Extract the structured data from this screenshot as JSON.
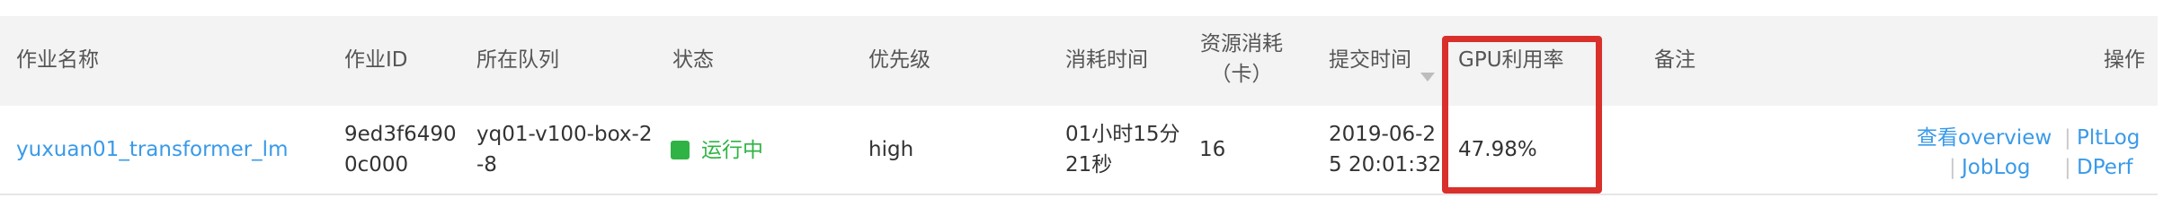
{
  "headers": {
    "name": "作业名称",
    "id": "作业ID",
    "queue": "所在队列",
    "status": "状态",
    "priority": "优先级",
    "elapsed": "消耗时间",
    "resource_line1": "资源消耗",
    "resource_line2": "（卡）",
    "submit": "提交时间",
    "gpu": "GPU利用率",
    "note": "备注",
    "actions": "操作"
  },
  "row": {
    "name": "yuxuan01_transformer_lm",
    "id_line1": "9ed3f6490",
    "id_line2": "0c000",
    "queue_line1": "yq01-v100-box-2",
    "queue_line2": "-8",
    "status": "运行中",
    "priority": "high",
    "elapsed_line1": "01小时15分",
    "elapsed_line2": "21秒",
    "resource": "16",
    "submit_line1": "2019-06-2",
    "submit_line2": "5 20:01:32",
    "gpu": "47.98%",
    "note": "",
    "actions": {
      "overview": "查看overview",
      "pltlog": "PltLog",
      "joblog": "JobLog",
      "dperf": "DPerf",
      "separator": "|"
    }
  },
  "colors": {
    "link": "#3a9ae8",
    "status_running": "#2fb344",
    "highlight": "#d9302c",
    "header_bg": "#f3f3f3"
  }
}
